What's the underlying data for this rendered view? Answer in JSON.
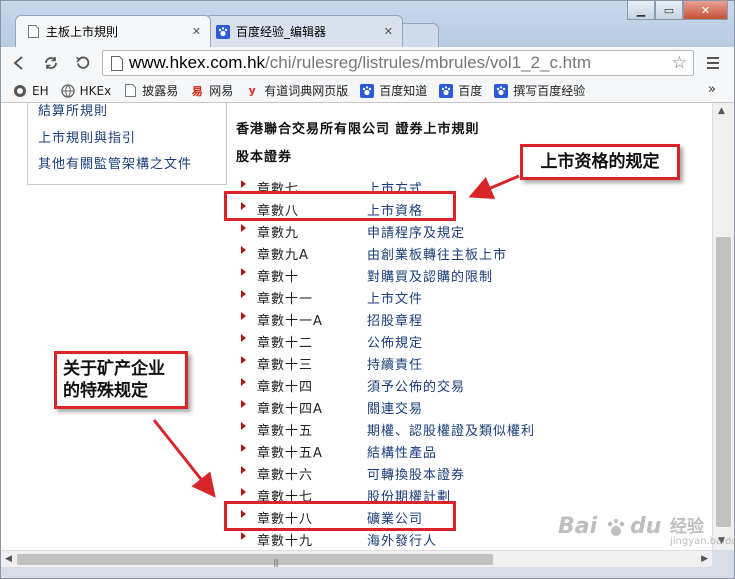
{
  "browser": {
    "tabs": [
      {
        "title": "主板上市規則",
        "active": true
      },
      {
        "title": "百度经验_编辑器",
        "active": false
      }
    ],
    "window_buttons": {
      "minimize": "▁",
      "maximize": "▭",
      "close": "✕"
    },
    "url": {
      "host": "www.hkex.com.hk",
      "path": "/chi/rulesreg/listrules/mbrules/vol1_2_c.htm"
    },
    "bookmarks": [
      {
        "label": "EH",
        "icon": "eh-icon"
      },
      {
        "label": "HKEx",
        "icon": "globe-icon"
      },
      {
        "label": "披露易",
        "icon": "doc-icon"
      },
      {
        "label": "网易",
        "icon": "netease-icon"
      },
      {
        "label": "有道词典网页版",
        "icon": "youdao-icon"
      },
      {
        "label": "百度知道",
        "icon": "baidu-paw-icon"
      },
      {
        "label": "百度",
        "icon": "baidu-paw-icon"
      },
      {
        "label": "撰写百度经验",
        "icon": "baidu-paw-icon"
      }
    ],
    "bookmarks_more": "»"
  },
  "sidebar": {
    "links": [
      "結算所規則",
      "上市規則與指引",
      "其他有關監管架構之文件"
    ]
  },
  "main": {
    "title": "香港聯合交易所有限公司 證券上市規則",
    "section": "股本證券",
    "chapters": [
      {
        "chapter": "章數七",
        "title": "上市方式"
      },
      {
        "chapter": "章數八",
        "title": "上市資格"
      },
      {
        "chapter": "章數九",
        "title": "申請程序及規定"
      },
      {
        "chapter": "章數九A",
        "title": "由創業板轉往主板上市"
      },
      {
        "chapter": "章數十",
        "title": "對購買及認購的限制"
      },
      {
        "chapter": "章數十一",
        "title": "上市文件"
      },
      {
        "chapter": "章數十一A",
        "title": "招股章程"
      },
      {
        "chapter": "章數十二",
        "title": "公佈規定"
      },
      {
        "chapter": "章數十三",
        "title": "持續責任"
      },
      {
        "chapter": "章數十四",
        "title": "須予公佈的交易"
      },
      {
        "chapter": "章數十四A",
        "title": "關連交易"
      },
      {
        "chapter": "章數十五",
        "title": "期權、認股權證及類似權利"
      },
      {
        "chapter": "章數十五A",
        "title": "結構性產品"
      },
      {
        "chapter": "章數十六",
        "title": "可轉換股本證券"
      },
      {
        "chapter": "章數十七",
        "title": "股份期權計劃"
      },
      {
        "chapter": "章數十八",
        "title": "礦業公司"
      },
      {
        "chapter": "章數十九",
        "title": "海外發行人"
      }
    ]
  },
  "annotations": {
    "callout_listing": "上市资格的规定",
    "callout_mining_line1": "关于矿产企业",
    "callout_mining_line2": "的特殊规定",
    "accent_color": "#d9242a"
  },
  "watermark": {
    "logo": "Bai",
    "text": "经验",
    "sub": "jingyan.baidu.com"
  }
}
